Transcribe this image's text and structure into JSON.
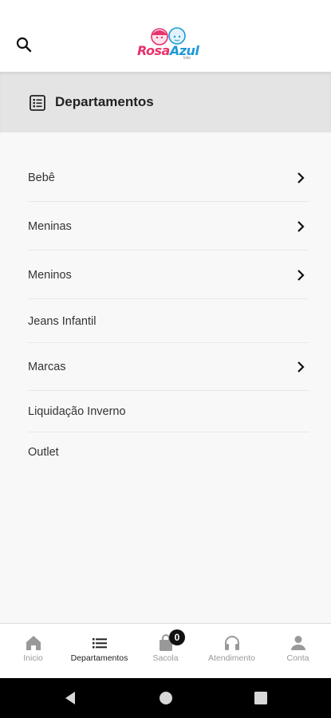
{
  "header": {
    "logo_rosa": "Rosa",
    "logo_azul": "Azul",
    "logo_sub": "kids"
  },
  "departments": {
    "title": "Departamentos",
    "items": [
      {
        "label": "Bebê",
        "has_children": true
      },
      {
        "label": "Meninas",
        "has_children": true
      },
      {
        "label": "Meninos",
        "has_children": true
      },
      {
        "label": "Jeans Infantil",
        "has_children": false
      },
      {
        "label": "Marcas",
        "has_children": true
      },
      {
        "label": "Liquidação Inverno",
        "has_children": false
      },
      {
        "label": "Outlet",
        "has_children": false
      }
    ]
  },
  "bottom_nav": {
    "items": [
      {
        "label": "Inicio",
        "icon": "home-icon"
      },
      {
        "label": "Departamentos",
        "icon": "list-icon",
        "active": true
      },
      {
        "label": "Sacola",
        "icon": "bag-icon",
        "badge": "0"
      },
      {
        "label": "Atendimento",
        "icon": "headset-icon"
      },
      {
        "label": "Conta",
        "icon": "person-icon"
      }
    ]
  },
  "colors": {
    "rosa": "#e8336d",
    "azul": "#1b9ad6",
    "header_bg": "#e4e4e4",
    "active": "#222222",
    "inactive": "#999999"
  }
}
